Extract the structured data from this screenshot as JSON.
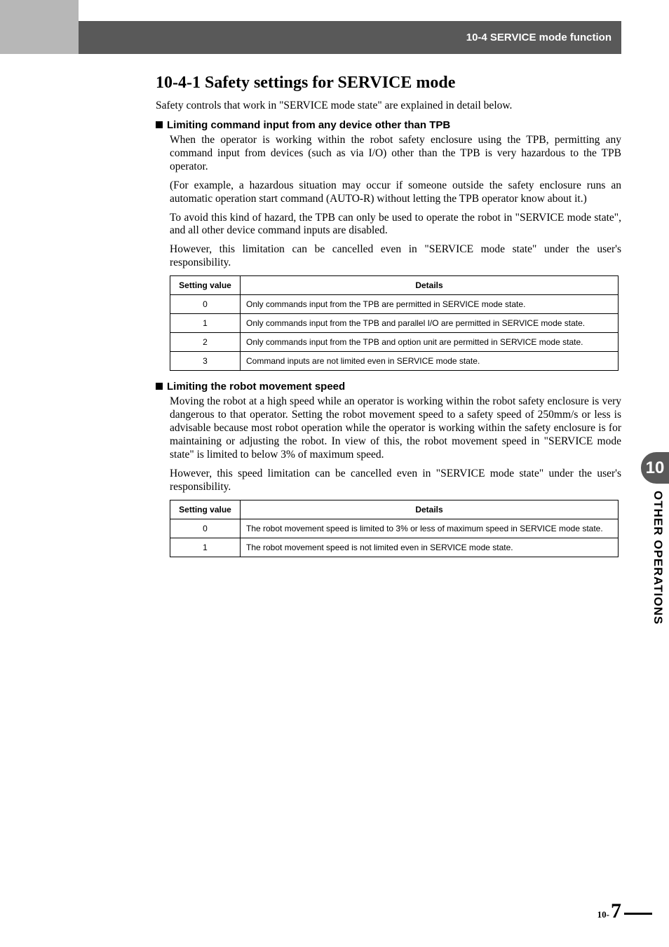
{
  "header": {
    "title": "10-4 SERVICE mode function"
  },
  "section": {
    "heading": "10-4-1 Safety settings for SERVICE mode",
    "intro": "Safety controls that work in \"SERVICE mode state\" are explained in detail below.",
    "block1": {
      "title": "Limiting command input from any device other than TPB",
      "p1": "When the operator is working within the robot safety enclosure using the TPB, permitting any command input from devices (such as via I/O) other than the TPB is very hazardous to the TPB operator.",
      "p2": "(For example, a hazardous situation may occur if someone outside the safety enclosure runs an automatic operation start command (AUTO-R) without letting the TPB operator know about it.)",
      "p3": "To avoid this kind of hazard, the TPB can only be used to operate the robot in \"SERVICE mode state\", and all other device command inputs are disabled.",
      "p4": "However, this limitation can be cancelled even in \"SERVICE mode state\" under the user's responsibility.",
      "table": {
        "cols": [
          "Setting value",
          "Details"
        ],
        "rows": [
          {
            "v": "0",
            "d": "Only commands input from the TPB are permitted in SERVICE mode state."
          },
          {
            "v": "1",
            "d": "Only commands input from the TPB and parallel I/O are permitted in SERVICE mode state."
          },
          {
            "v": "2",
            "d": "Only commands input from the TPB and option unit are permitted in SERVICE mode state."
          },
          {
            "v": "3",
            "d": "Command inputs are not limited even in SERVICE mode state."
          }
        ]
      }
    },
    "block2": {
      "title": "Limiting the robot movement speed",
      "p1": "Moving the robot at a high speed while an operator is working within the robot safety enclosure is very dangerous to that operator. Setting the robot movement speed to a safety speed of 250mm/s or less is advisable because most robot operation while the operator is working within the safety enclosure is for maintaining or adjusting the robot. In view of this, the robot movement speed in \"SERVICE mode state\" is limited to below 3% of maximum speed.",
      "p2": "However, this speed limitation can be cancelled even in \"SERVICE mode state\" under the user's responsibility.",
      "table": {
        "cols": [
          "Setting value",
          "Details"
        ],
        "rows": [
          {
            "v": "0",
            "d": "The robot movement speed is limited to 3% or less of maximum speed in SERVICE mode state."
          },
          {
            "v": "1",
            "d": "The robot movement speed is not limited even in SERVICE mode state."
          }
        ]
      }
    }
  },
  "side": {
    "chapter": "10",
    "label": "OTHER OPERATIONS"
  },
  "footer": {
    "prefix": "10-",
    "page": "7"
  }
}
